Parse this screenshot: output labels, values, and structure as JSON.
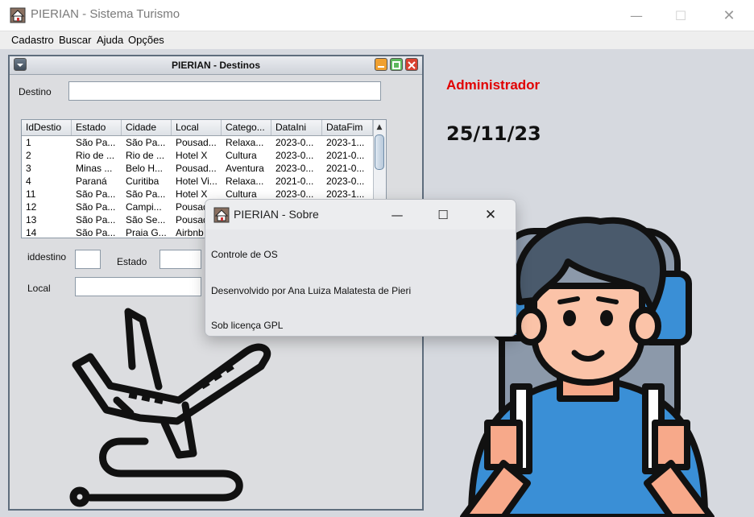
{
  "window": {
    "title": "PIERIAN - Sistema Turismo",
    "minimize": "—",
    "maximize": "☐",
    "close": "✕"
  },
  "menu": [
    "Cadastro",
    "Buscar",
    "Ajuda",
    "Opções"
  ],
  "destinos": {
    "title": "PIERIAN - Destinos",
    "destino_label": "Destino",
    "destino_value": "",
    "columns": [
      "IdDestio",
      "Estado",
      "Cidade",
      "Local",
      "Catego...",
      "DataIni",
      "DataFim"
    ],
    "rows": [
      [
        "1",
        "São Pa...",
        "São Pa...",
        "Pousad...",
        "Relaxa...",
        "2023-0...",
        "2023-1..."
      ],
      [
        "2",
        "Rio de ...",
        "Rio de ...",
        "Hotel X",
        "Cultura",
        "2023-0...",
        "2021-0..."
      ],
      [
        "3",
        "Minas ...",
        "Belo H...",
        "Pousad...",
        "Aventura",
        "2023-0...",
        "2021-0..."
      ],
      [
        "4",
        "Paraná",
        "Curitiba",
        "Hotel Vi...",
        "Relaxa...",
        "2021-0...",
        "2023-0..."
      ],
      [
        "11",
        "São Pa...",
        "São Pa...",
        "Hotel X",
        "Cultura",
        "2023-0...",
        "2023-1..."
      ],
      [
        "12",
        "São Pa...",
        "Campi...",
        "Pousad...",
        "",
        "",
        ""
      ],
      [
        "13",
        "São Pa...",
        "São Se...",
        "Pousad...",
        "",
        "",
        ""
      ],
      [
        "14",
        "São Pa...",
        "Praia G...",
        "Airbnb",
        "",
        "",
        ""
      ]
    ],
    "iddestino_label": "iddestino",
    "estado_label": "Estado",
    "local_label": "Local",
    "scroll_up": "▲"
  },
  "sobre": {
    "title": "PIERIAN - Sobre",
    "minimize": "—",
    "maximize": "☐",
    "close": "✕",
    "line1": "Controle de OS",
    "line2": "Desenvolvido por Ana Luiza Malatesta de Pieri",
    "line3": "Sob licença GPL"
  },
  "user": "Administrador",
  "date": "25/11/23",
  "colors": {
    "admin": "#e10000",
    "titlebar_minimize": "#f0a030",
    "titlebar_maximize": "#5cb85c",
    "titlebar_close": "#d9412f"
  }
}
